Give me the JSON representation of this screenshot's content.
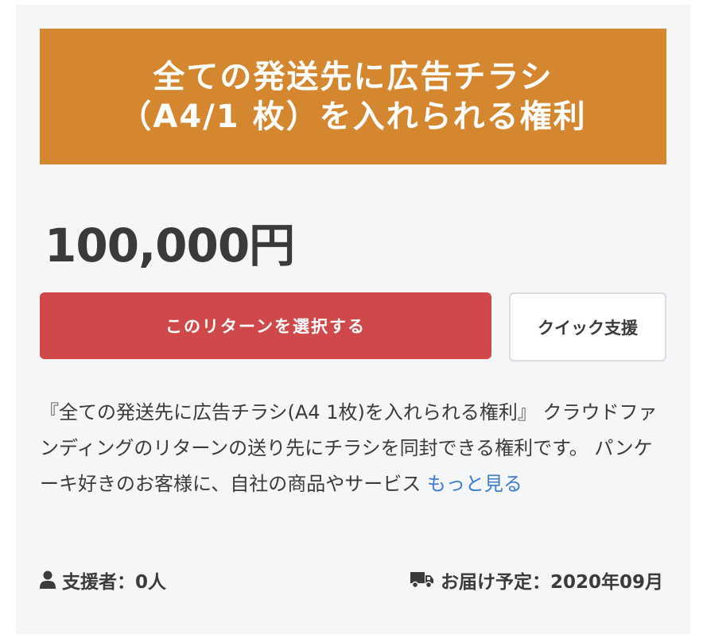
{
  "banner": {
    "line1": "全ての発送先に広告チラシ",
    "line2": "（A4/1 枚）を入れられる権利"
  },
  "price": "100,000円",
  "buttons": {
    "select_label": "このリターンを選択する",
    "quick_label": "クイック支援"
  },
  "description": {
    "text": "『全ての発送先に広告チラシ(A4 1枚)を入れられる権利』 クラウドファンディングのリターンの送り先にチラシを同封できる権利です。 パンケーキ好きのお客様に、自社の商品やサービス ",
    "more_label": "もっと見る"
  },
  "meta": {
    "supporters_label": "支援者：0人",
    "delivery_label": "お届け予定：2020年09月",
    "supporters_icon": "user-icon",
    "delivery_icon": "truck-icon"
  },
  "colors": {
    "banner_bg": "#d4872e",
    "select_button_bg": "#d0494a",
    "link": "#3c7bd1"
  }
}
